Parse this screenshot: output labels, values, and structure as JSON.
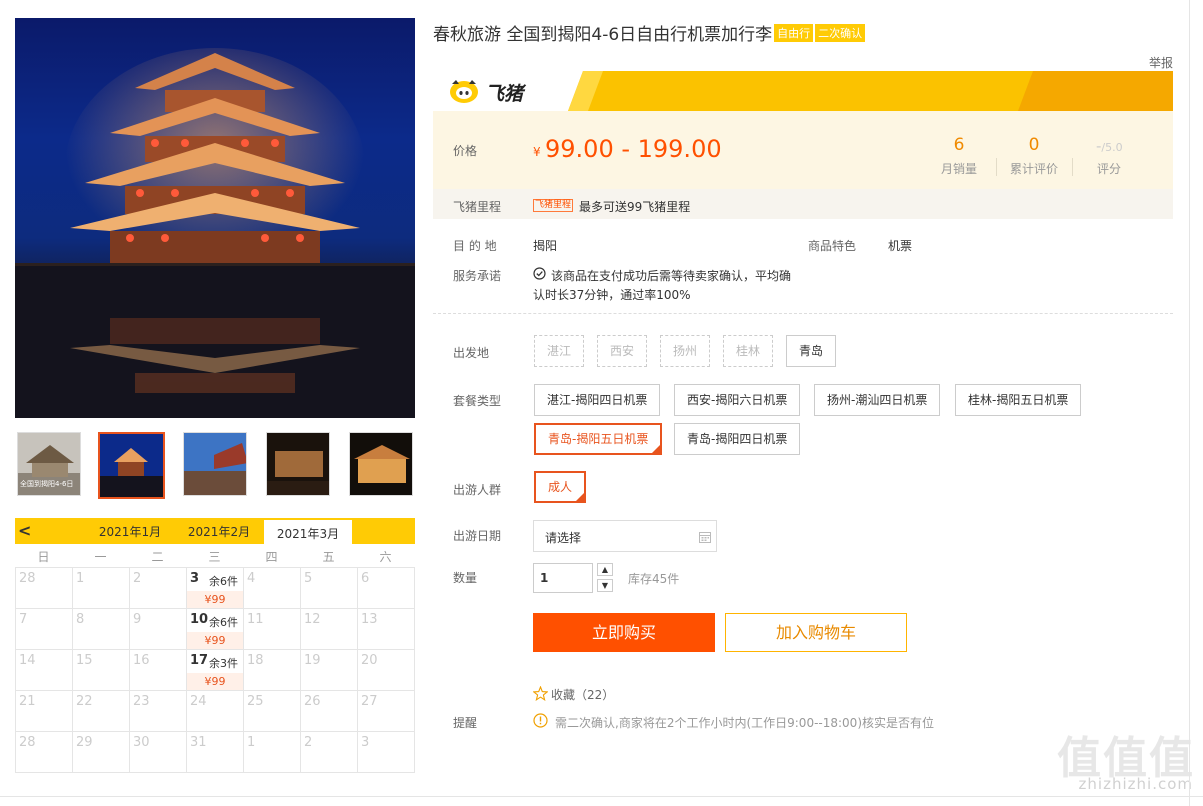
{
  "product": {
    "title": "春秋旅游 全国到揭阳4-6日自由行机票加行李",
    "tags": [
      "自由行",
      "二次确认"
    ],
    "report": "举报"
  },
  "banner": {
    "brand": "飞猪",
    "accent_color": "#fbc200"
  },
  "price": {
    "label": "价格",
    "currency": "¥",
    "range": "99.00 - 199.00",
    "stats": [
      {
        "value": "6",
        "label": "月销量"
      },
      {
        "value": "0",
        "label": "累计评价"
      },
      {
        "value": "-",
        "sub": "/5.0",
        "label": "评分"
      }
    ]
  },
  "mileage": {
    "label": "飞猪里程",
    "badge": "飞猪里程",
    "text": "最多可送99飞猪里程"
  },
  "info": {
    "dest_label": "目 的 地",
    "dest_value": "揭阳",
    "feature_label": "商品特色",
    "feature_value": "机票",
    "service_label": "服务承诺",
    "service_text_1": "该商品在支付成功后需等待卖家确认，平均确",
    "service_text_2": "认时长37分钟，通过率100%"
  },
  "options": {
    "depart_label": "出发地",
    "departs": [
      "湛江",
      "西安",
      "扬州",
      "桂林",
      "青岛"
    ],
    "package_label": "套餐类型",
    "packages": [
      "湛江-揭阳四日机票",
      "西安-揭阳六日机票",
      "扬州-潮汕四日机票",
      "桂林-揭阳五日机票",
      "青岛-揭阳五日机票",
      "青岛-揭阳四日机票"
    ],
    "traveler_label": "出游人群",
    "traveler": "成人",
    "date_label": "出游日期",
    "date_placeholder": "请选择",
    "qty_label": "数量",
    "qty_value": "1",
    "stock": "库存45件"
  },
  "actions": {
    "buy": "立即购买",
    "cart": "加入购物车",
    "favorite": "收藏（22）"
  },
  "reminder": {
    "label": "提醒",
    "text": "需二次确认,商家将在2个工作小时内(工作日9:00--18:00)核实是否有位"
  },
  "calendar": {
    "prev": "<",
    "months": [
      "2021年1月",
      "2021年2月",
      "2021年3月"
    ],
    "weekdays": [
      "日",
      "一",
      "二",
      "三",
      "四",
      "五",
      "六"
    ],
    "rows": [
      [
        {
          "d": "28"
        },
        {
          "d": "1"
        },
        {
          "d": "2"
        },
        {
          "d": "3",
          "stock": "余6件",
          "price": "¥99"
        },
        {
          "d": "4"
        },
        {
          "d": "5"
        },
        {
          "d": "6"
        }
      ],
      [
        {
          "d": "7"
        },
        {
          "d": "8"
        },
        {
          "d": "9"
        },
        {
          "d": "10",
          "stock": "余6件",
          "price": "¥99"
        },
        {
          "d": "11"
        },
        {
          "d": "12"
        },
        {
          "d": "13"
        }
      ],
      [
        {
          "d": "14"
        },
        {
          "d": "15"
        },
        {
          "d": "16"
        },
        {
          "d": "17",
          "stock": "余3件",
          "price": "¥99"
        },
        {
          "d": "18"
        },
        {
          "d": "19"
        },
        {
          "d": "20"
        }
      ],
      [
        {
          "d": "21"
        },
        {
          "d": "22"
        },
        {
          "d": "23"
        },
        {
          "d": "24"
        },
        {
          "d": "25"
        },
        {
          "d": "26"
        },
        {
          "d": "27"
        }
      ],
      [
        {
          "d": "28"
        },
        {
          "d": "29"
        },
        {
          "d": "30"
        },
        {
          "d": "31"
        },
        {
          "d": "1"
        },
        {
          "d": "2"
        },
        {
          "d": "3"
        }
      ]
    ]
  },
  "thumbnail_caption": "全国到揭阳4-6日",
  "watermark": {
    "logo": "值值值",
    "url": "zhizhizhi.com"
  }
}
